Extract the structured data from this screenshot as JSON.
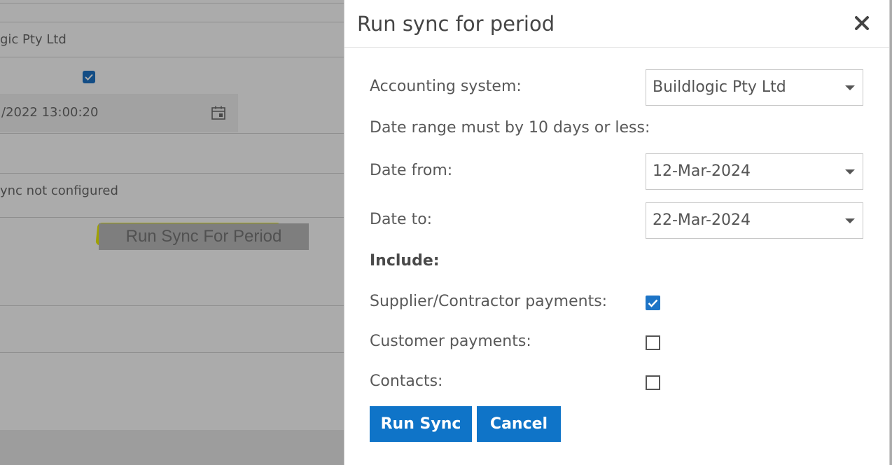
{
  "background_page": {
    "company_text": "gic Pty Ltd",
    "date_value": "/2022 13:00:20",
    "sync_status": "ync not configured",
    "run_sync_button_label": "Run Sync For Period"
  },
  "modal": {
    "title": "Run sync for period",
    "accounting_system": {
      "label": "Accounting system:",
      "value": "Buildlogic Pty Ltd"
    },
    "date_range_note": "Date range must by 10 days or less:",
    "date_from": {
      "label": "Date from:",
      "value": "12-Mar-2024"
    },
    "date_to": {
      "label": "Date to:",
      "value": "22-Mar-2024"
    },
    "include_heading": "Include:",
    "options": {
      "supplier_payments": {
        "label": "Supplier/Contractor payments:",
        "checked": true
      },
      "customer_payments": {
        "label": "Customer payments:",
        "checked": false
      },
      "contacts": {
        "label": "Contacts:",
        "checked": false
      }
    },
    "buttons": {
      "run_sync": "Run Sync",
      "cancel": "Cancel"
    }
  },
  "colors": {
    "primary_button": "#0f74c8",
    "checkbox_checked": "#1d74c6",
    "highlight": "#eef000",
    "overlay": "rgba(0,0,0,0.33)"
  }
}
